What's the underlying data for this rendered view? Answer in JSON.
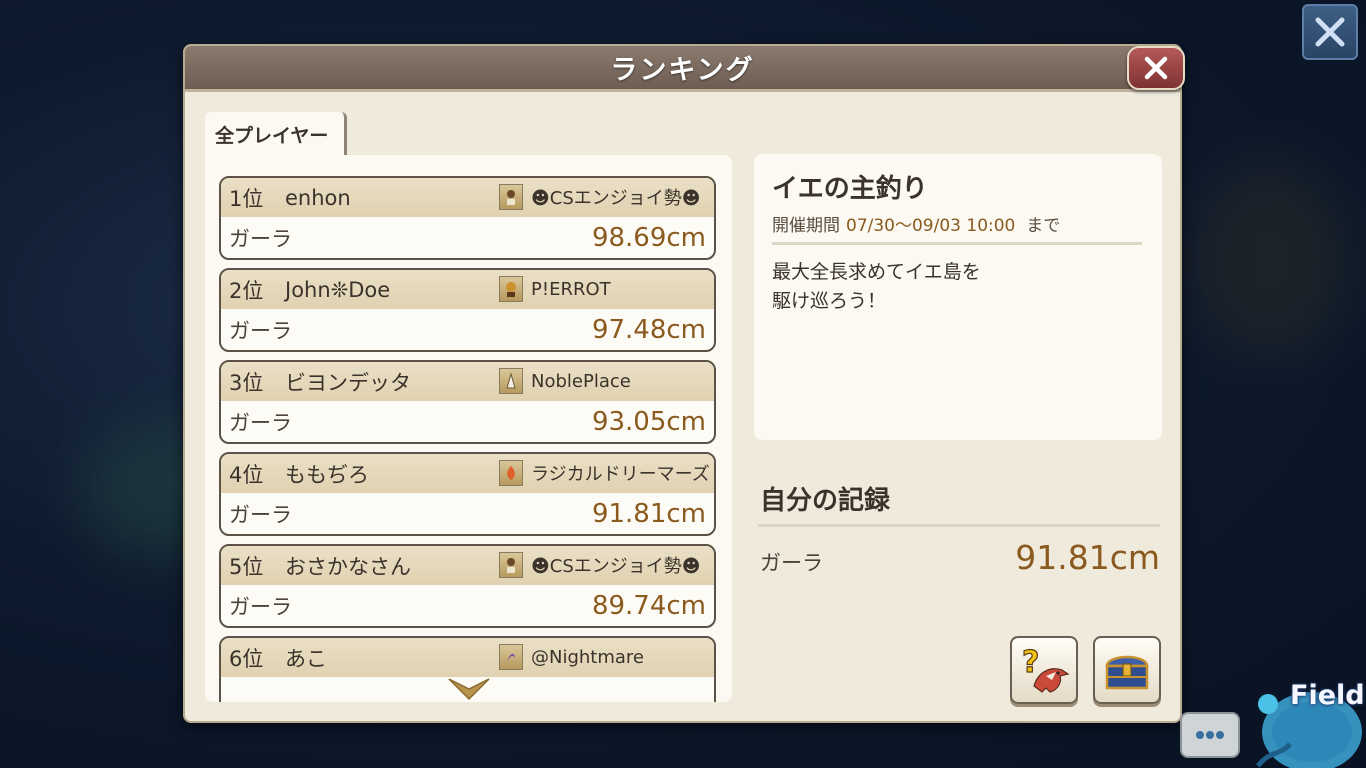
{
  "panel": {
    "title": "ランキング"
  },
  "tabs": [
    {
      "label": "全プレイヤー"
    }
  ],
  "ranking": [
    {
      "rank": "1位",
      "name": "enhon",
      "team": "☻CSエンジョイ勢☻",
      "fish": "ガーラ",
      "size": "98.69cm"
    },
    {
      "rank": "2位",
      "name": "John❊Doe",
      "team": "P!ERROT",
      "fish": "ガーラ",
      "size": "97.48cm"
    },
    {
      "rank": "3位",
      "name": "ビヨンデッタ",
      "team": "NoblePlace",
      "fish": "ガーラ",
      "size": "93.05cm"
    },
    {
      "rank": "4位",
      "name": "ももぢろ",
      "team": "ラジカルドリーマーズ",
      "fish": "ガーラ",
      "size": "91.81cm"
    },
    {
      "rank": "5位",
      "name": "おさかなさん",
      "team": "☻CSエンジョイ勢☻",
      "fish": "ガーラ",
      "size": "89.74cm"
    },
    {
      "rank": "6位",
      "name": "あこ",
      "team": "@Nightmare",
      "fish": "",
      "size": ""
    }
  ],
  "event": {
    "title": "イエの主釣り",
    "period_label": "開催期間",
    "period_value": "07/30〜09/03 10:00",
    "period_suffix": "まで",
    "description_line1": "最大全長求めてイエ島を",
    "description_line2": "駆け巡ろう！"
  },
  "my_record": {
    "title": "自分の記録",
    "fish": "ガーラ",
    "size": "91.81cm"
  },
  "overlay": {
    "field_label": "Field"
  },
  "icons": {
    "screen_close": "close-icon",
    "panel_close": "close-icon",
    "scroll": "chevron-down-icon",
    "help": "help-bird-icon",
    "reward": "treasure-chest-icon",
    "chat": "chat-bubble-icon"
  },
  "colors": {
    "accent_size": "#8a5a1e",
    "header": "#7a6a5e",
    "close_red": "#9c4545"
  }
}
